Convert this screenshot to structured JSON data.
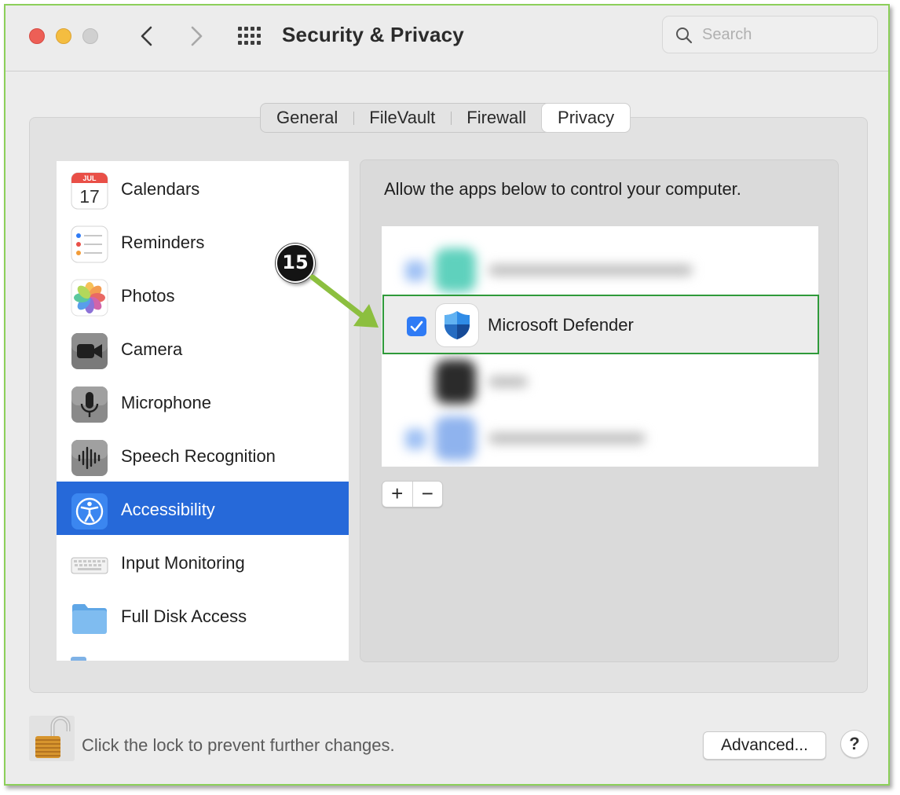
{
  "window": {
    "title": "Security & Privacy",
    "search_placeholder": "Search"
  },
  "tabs": [
    {
      "label": "General"
    },
    {
      "label": "FileVault"
    },
    {
      "label": "Firewall"
    },
    {
      "label": "Privacy",
      "selected": true
    }
  ],
  "sidebar": {
    "items": [
      {
        "label": "Calendars",
        "icon": "calendar-icon",
        "icon_month": "JUL",
        "icon_day": "17"
      },
      {
        "label": "Reminders",
        "icon": "reminders-icon"
      },
      {
        "label": "Photos",
        "icon": "photos-icon"
      },
      {
        "label": "Camera",
        "icon": "camera-icon"
      },
      {
        "label": "Microphone",
        "icon": "microphone-icon"
      },
      {
        "label": "Speech Recognition",
        "icon": "speech-recognition-icon"
      },
      {
        "label": "Accessibility",
        "icon": "accessibility-icon",
        "selected": true
      },
      {
        "label": "Input Monitoring",
        "icon": "keyboard-icon"
      },
      {
        "label": "Full Disk Access",
        "icon": "folder-icon"
      }
    ]
  },
  "panel": {
    "description": "Allow the apps below to control your computer.",
    "apps": [
      {
        "name": "Microsoft Defender",
        "checked": true,
        "icon": "microsoft-defender-shield-icon"
      }
    ],
    "add_label": "+",
    "remove_label": "−"
  },
  "annotation": {
    "step_number": "15"
  },
  "footer": {
    "lock_text": "Click the lock to prevent further changes.",
    "advanced_label": "Advanced...",
    "help_label": "?"
  },
  "colors": {
    "selection_blue": "#2669d9",
    "checkbox_blue": "#2f7bf5",
    "highlight_green": "#2f9a3a",
    "arrow_green": "#8cbf3f",
    "window_border": "#8ccf5a"
  }
}
